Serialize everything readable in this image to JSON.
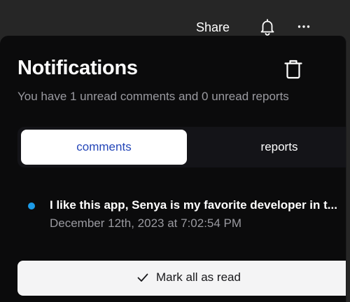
{
  "topbar": {
    "share_label": "Share",
    "bell_icon": "bell-icon",
    "more_icon": "more-horizontal-icon"
  },
  "panel": {
    "title": "Notifications",
    "delete_icon": "trash-icon",
    "subtitle": "You have 1 unread comments and 0 unread reports"
  },
  "tabs": [
    {
      "label": "comments",
      "active": true
    },
    {
      "label": "reports",
      "active": false
    }
  ],
  "notifications": [
    {
      "text": "I like this app, Senya is my favorite developer in t...",
      "time": "December 12th, 2023 at 7:02:54 PM",
      "unread": true
    }
  ],
  "actions": {
    "mark_all_read_label": "Mark all as read",
    "mark_icon": "check-icon"
  },
  "colors": {
    "page_background": "#262626",
    "panel_background": "#0b0b0c",
    "tab_active_text": "#2446b8",
    "unread_dot": "#1c9be8",
    "muted_text": "#9a9aa0"
  }
}
